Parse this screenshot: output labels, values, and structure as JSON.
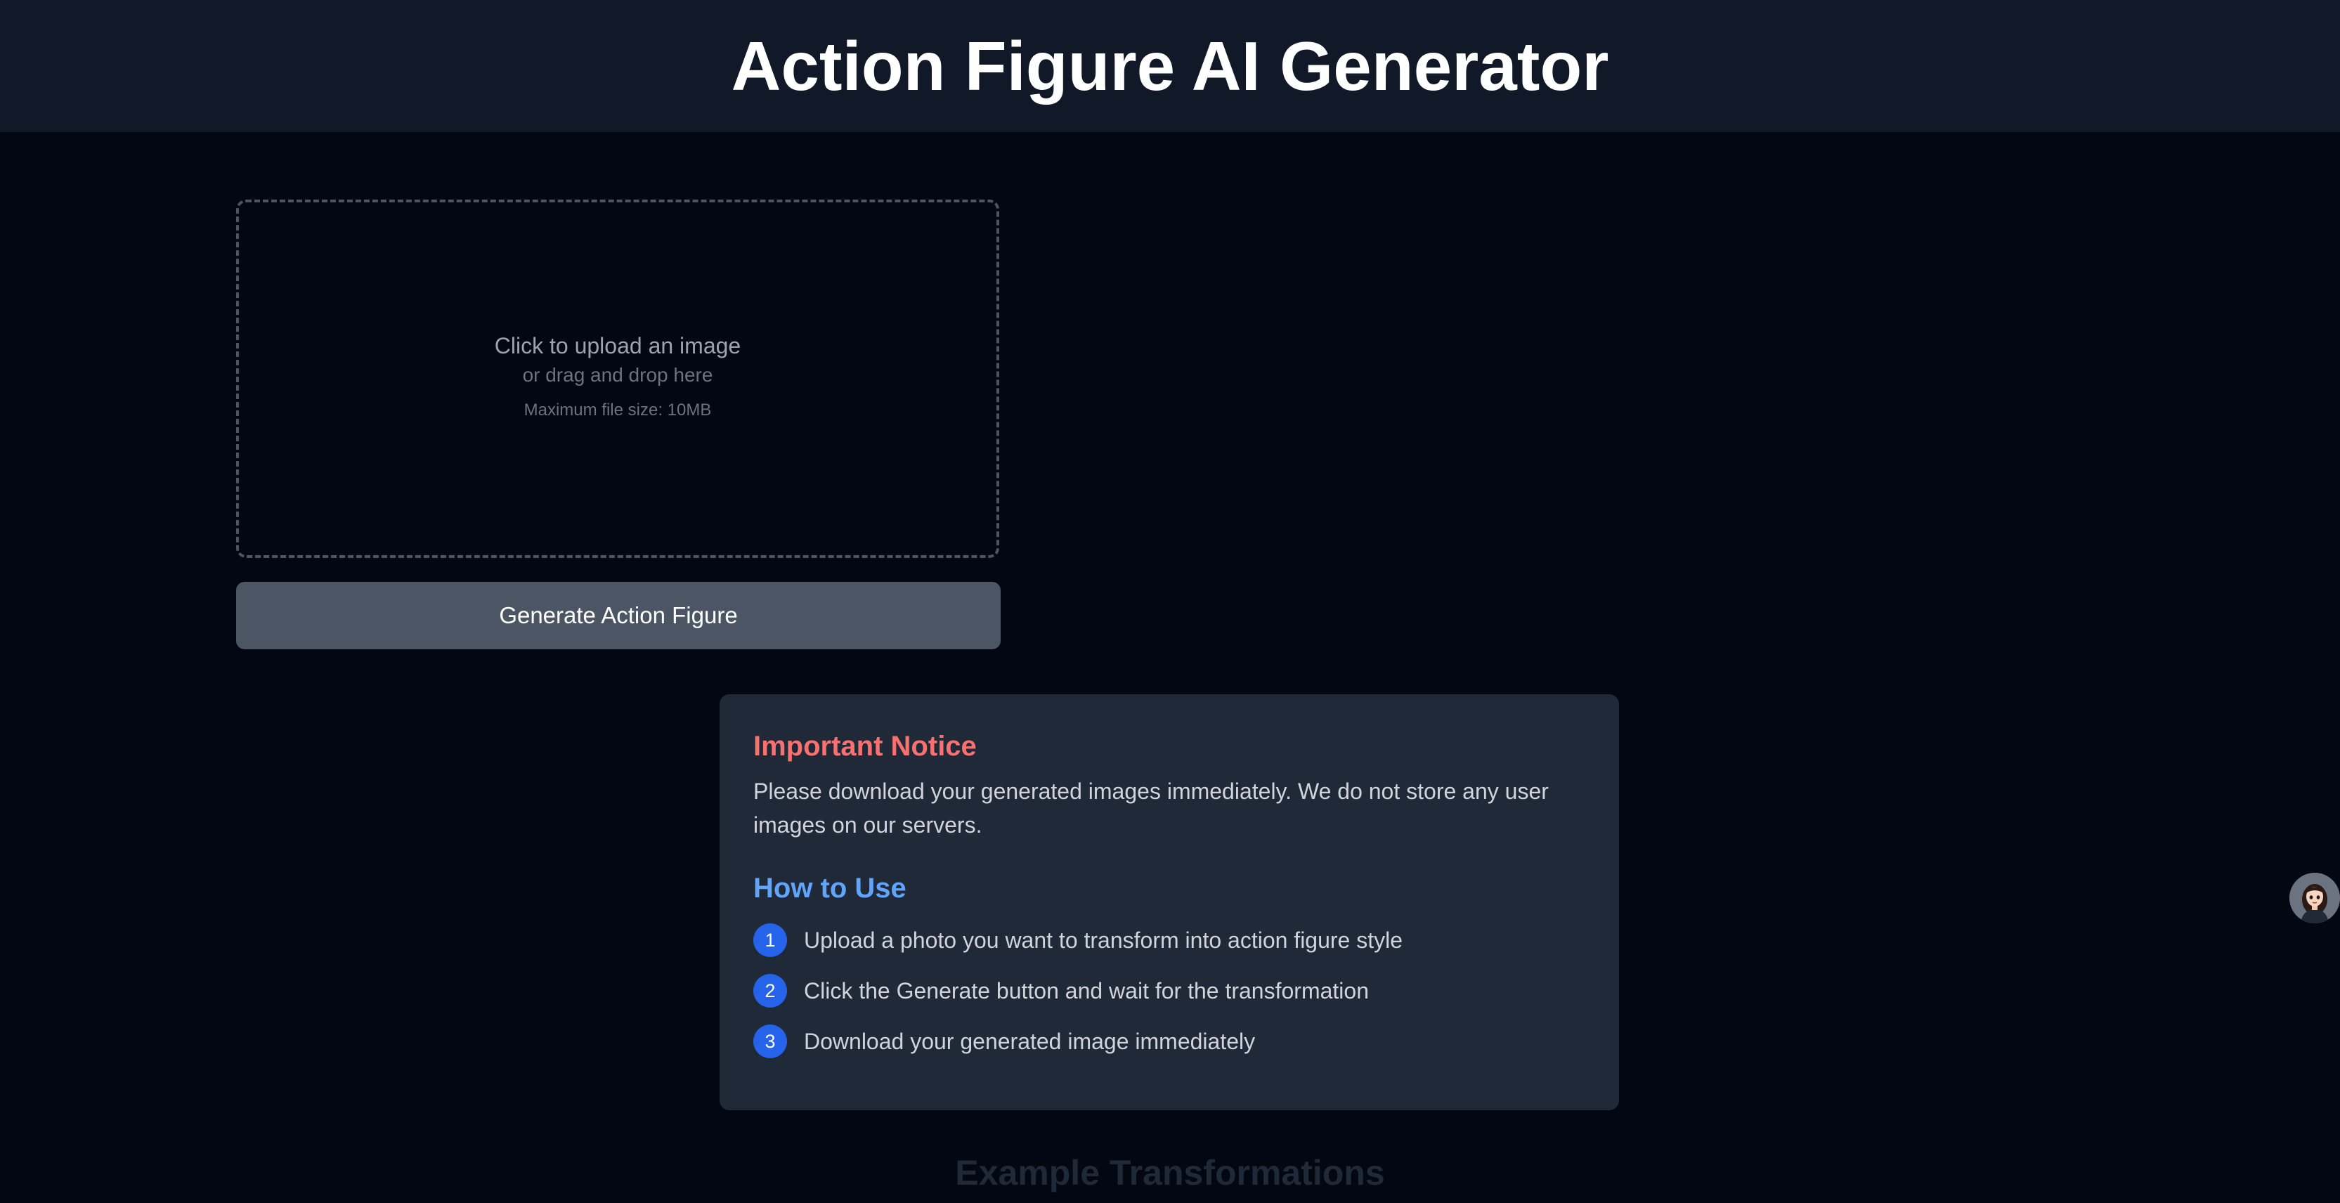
{
  "header": {
    "title": "Action Figure AI Generator"
  },
  "upload": {
    "title": "Click to upload an image",
    "subtitle": "or drag and drop here",
    "max_size": "Maximum file size: 10MB"
  },
  "generate_button": {
    "label": "Generate Action Figure"
  },
  "notice": {
    "title": "Important Notice",
    "text": "Please download your generated images immediately. We do not store any user images on our servers."
  },
  "how_to": {
    "title": "How to Use",
    "steps": [
      {
        "number": "1",
        "text": "Upload a photo you want to transform into action figure style"
      },
      {
        "number": "2",
        "text": "Click the Generate button and wait for the transformation"
      },
      {
        "number": "3",
        "text": "Download your generated image immediately"
      }
    ]
  },
  "examples": {
    "title": "Example Transformations"
  },
  "colors": {
    "background": "#030712",
    "header_bg": "#111827",
    "card_bg": "#1f2937",
    "notice_title": "#f87171",
    "howto_title": "#60a5fa",
    "step_badge": "#2563eb",
    "button_bg": "#4b5563"
  },
  "icons": {
    "avatar": "assistant-avatar-icon"
  }
}
